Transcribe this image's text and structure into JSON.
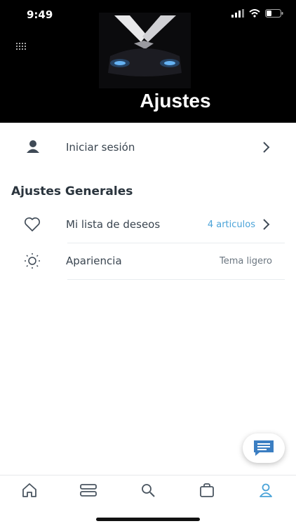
{
  "status_bar": {
    "time": "9:49"
  },
  "header": {
    "title": "Ajustes"
  },
  "login": {
    "label": "Iniciar sesión"
  },
  "general": {
    "title": "Ajustes Generales",
    "wishlist": {
      "label": "Mi lista de deseos",
      "value": "4 articulos"
    },
    "appearance": {
      "label": "Apariencia",
      "value": "Tema ligero"
    }
  },
  "tabs": [
    "home-icon",
    "catalog-icon",
    "search-icon",
    "bag-icon",
    "profile-icon"
  ],
  "colors": {
    "accent": "#4aa3d8",
    "header_bg": "#000000",
    "text": "#3a4550"
  }
}
